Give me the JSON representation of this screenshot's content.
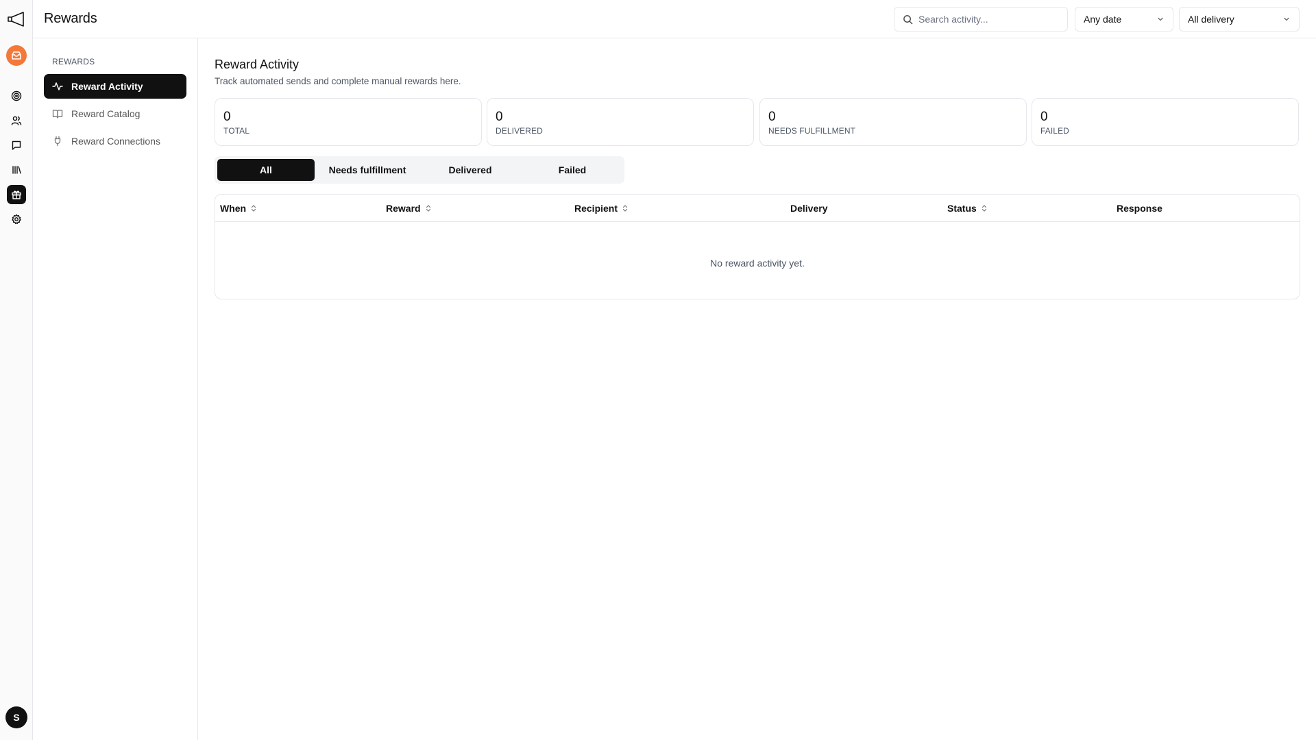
{
  "app": {
    "title": "Rewards",
    "user_initial": "S"
  },
  "rail": {
    "icons": [
      "megaphone-icon",
      "brand-logo",
      "target-icon",
      "users-icon",
      "chat-icon",
      "library-icon",
      "gift-icon",
      "settings-icon"
    ],
    "active": "gift-icon"
  },
  "topbar": {
    "search_placeholder": "Search activity...",
    "date_filter": "Any date",
    "delivery_filter": "All delivery"
  },
  "subnav": {
    "section": "REWARDS",
    "items": [
      {
        "label": "Reward Activity",
        "icon": "activity-icon",
        "active": true
      },
      {
        "label": "Reward Catalog",
        "icon": "book-icon",
        "active": false
      },
      {
        "label": "Reward Connections",
        "icon": "plug-icon",
        "active": false
      }
    ]
  },
  "page": {
    "title": "Reward Activity",
    "description": "Track automated sends and complete manual rewards here."
  },
  "stats": [
    {
      "value": "0",
      "label": "TOTAL"
    },
    {
      "value": "0",
      "label": "DELIVERED"
    },
    {
      "value": "0",
      "label": "NEEDS FULFILLMENT"
    },
    {
      "value": "0",
      "label": "FAILED"
    }
  ],
  "tabs": [
    {
      "label": "All",
      "active": true
    },
    {
      "label": "Needs fulfillment",
      "active": false
    },
    {
      "label": "Delivered",
      "active": false
    },
    {
      "label": "Failed",
      "active": false
    }
  ],
  "table": {
    "columns": [
      {
        "label": "When",
        "sortable": true
      },
      {
        "label": "Reward",
        "sortable": true
      },
      {
        "label": "Recipient",
        "sortable": true
      },
      {
        "label": "Delivery",
        "sortable": false
      },
      {
        "label": "Status",
        "sortable": true
      },
      {
        "label": "Response",
        "sortable": false
      }
    ],
    "empty_message": "No reward activity yet."
  },
  "colors": {
    "accent": "#111111",
    "brand": "#f4783a",
    "border": "#e5e7eb",
    "muted": "#4b5563"
  }
}
